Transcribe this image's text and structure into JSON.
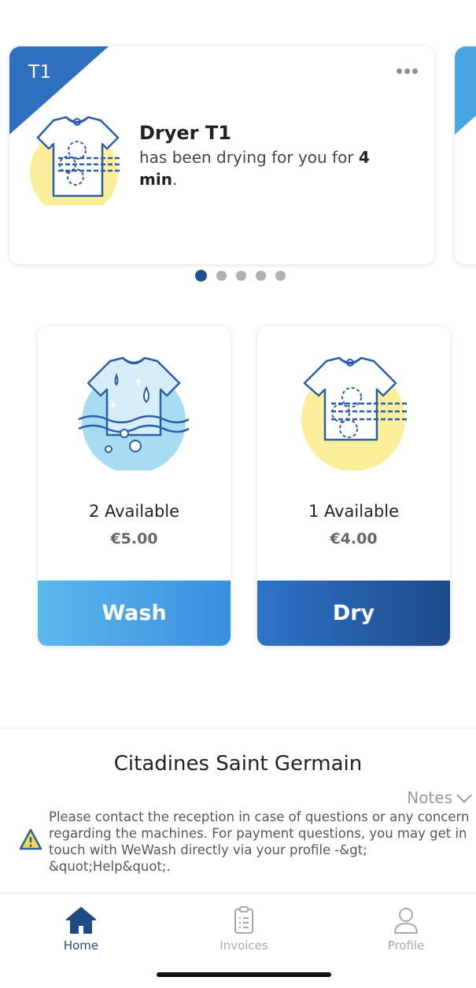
{
  "status_card": {
    "tab_label": "T1",
    "machine_name": "Dryer T1",
    "message_prefix": "has been drying for you for ",
    "duration": "4 min",
    "message_suffix": "."
  },
  "carousel": {
    "page_count": 5,
    "active_index": 0
  },
  "machines": [
    {
      "availability": "2 Available",
      "price": "€5.00",
      "action": "Wash"
    },
    {
      "availability": "1 Available",
      "price": "€4.00",
      "action": "Dry"
    }
  ],
  "location": {
    "name": "Citadines Saint Germain",
    "notes_label": "Notes",
    "notes_text": "Please contact the reception in case of questions or any concern regarding the machines. For payment questions, you may get in touch with WeWash directly via your profile -&gt; &quot;Help&quot;."
  },
  "nav": {
    "home": "Home",
    "invoices": "Invoices",
    "profile": "Profile"
  },
  "colors": {
    "primary_dark": "#1e4a86",
    "primary": "#2f6fbf",
    "light_blue": "#5bb8ec",
    "dryer_yellow": "#fbef9c",
    "wash_blue": "#a8dcf2"
  }
}
